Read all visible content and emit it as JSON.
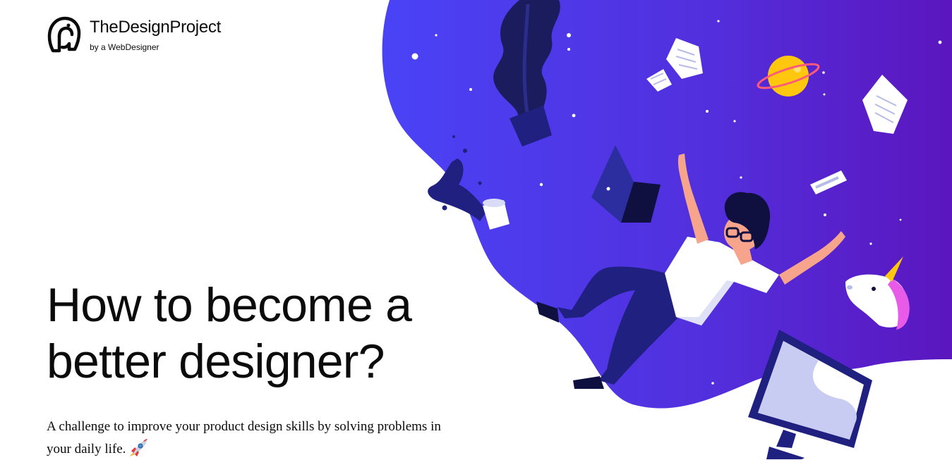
{
  "brand": {
    "name": "TheDesignProject",
    "tagline": "by a WebDesigner",
    "logo_icon": "elephant-logo-icon"
  },
  "hero": {
    "headline_line1": "How to become a",
    "headline_line2": "better designer?",
    "subtitle": "A challenge to improve your product design skills by solving problems in your daily life.",
    "subtitle_icon": "rocket-emoji-icon",
    "illustration": "falling-designer-illustration"
  },
  "colors": {
    "text": "#0b0b0b",
    "blob_start": "#4a43f6",
    "blob_end": "#5b16be",
    "navy": "#1f2080",
    "planet": "#ffc80f"
  }
}
